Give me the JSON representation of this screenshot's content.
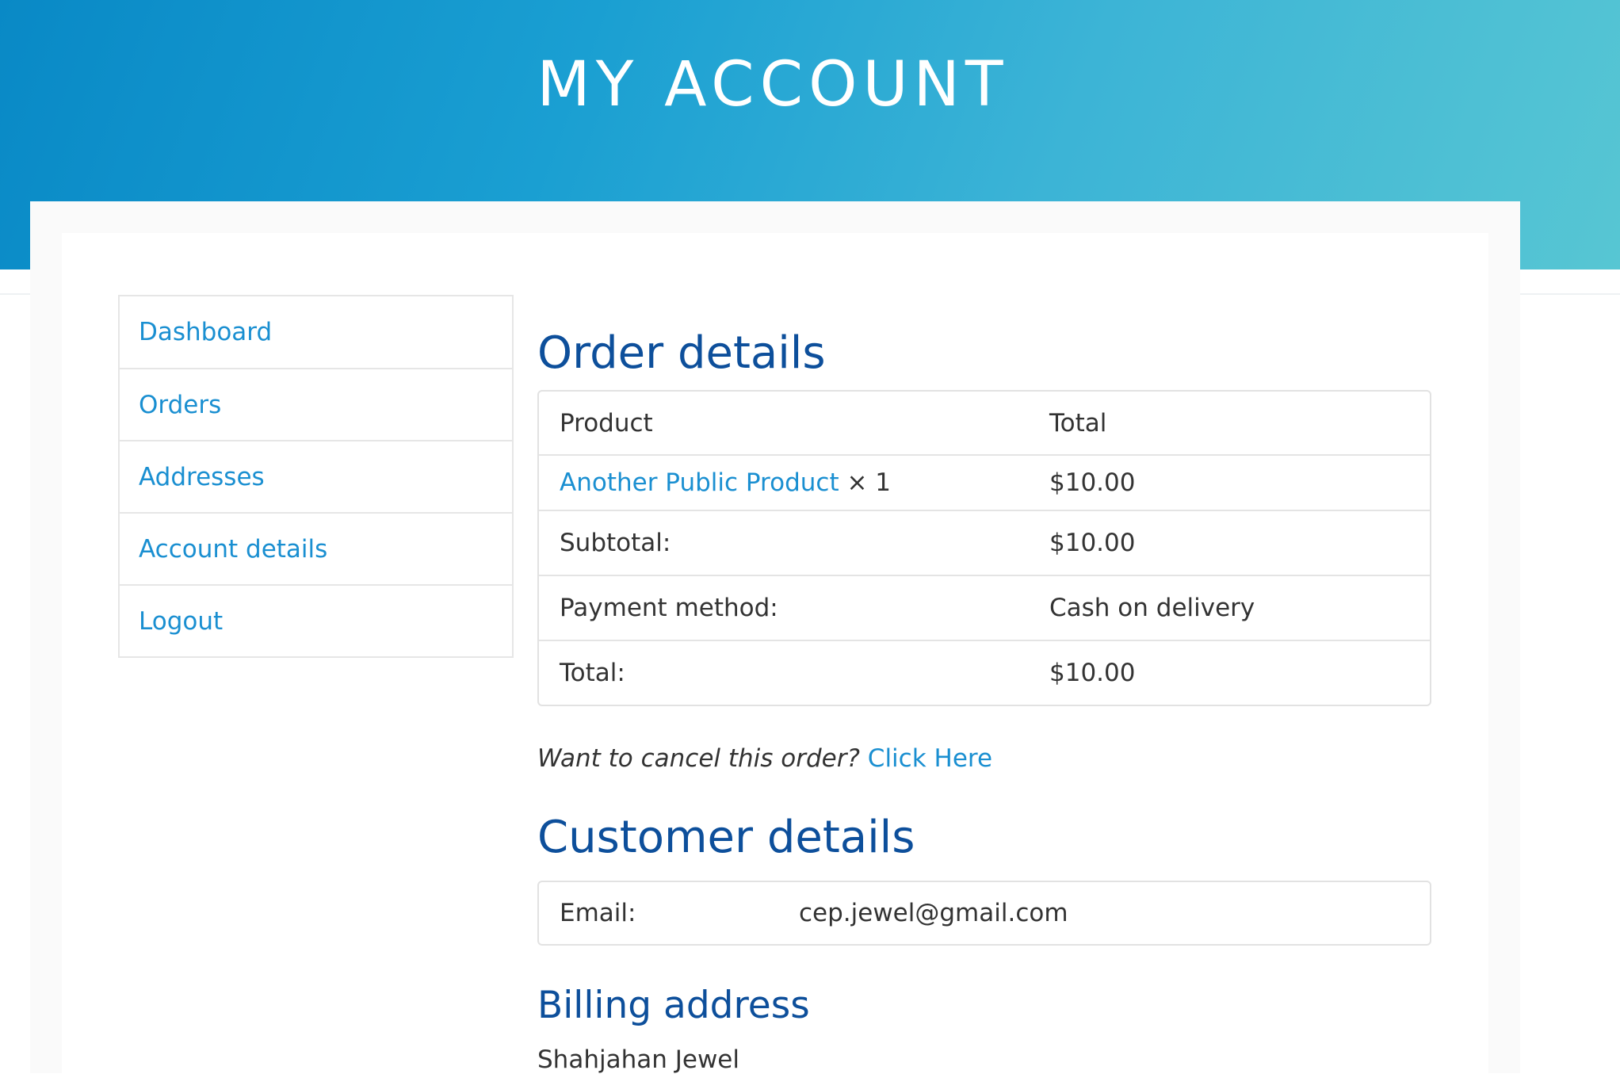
{
  "header": {
    "title": "MY ACCOUNT"
  },
  "sidebar": {
    "items": [
      {
        "label": "Dashboard"
      },
      {
        "label": "Orders"
      },
      {
        "label": "Addresses"
      },
      {
        "label": "Account details"
      },
      {
        "label": "Logout"
      }
    ]
  },
  "order": {
    "heading": "Order details",
    "columns": {
      "product": "Product",
      "total": "Total"
    },
    "item": {
      "name": "Another Public Product",
      "qty": "× 1",
      "total": "$10.00"
    },
    "subtotal": {
      "label": "Subtotal:",
      "value": "$10.00"
    },
    "payment": {
      "label": "Payment method:",
      "value": "Cash on delivery"
    },
    "grand_total": {
      "label": "Total:",
      "value": "$10.00"
    },
    "cancel": {
      "prompt": "Want to cancel this order?",
      "link": "Click Here"
    }
  },
  "customer": {
    "heading": "Customer details",
    "email_label": "Email:",
    "email": "cep.jewel@gmail.com"
  },
  "billing": {
    "heading": "Billing address",
    "name": "Shahjahan Jewel"
  },
  "colors": {
    "accent": "#1a8fd1",
    "heading": "#0d4f9b",
    "header_gradient_start": "#0989c6",
    "header_gradient_end": "#57c6d3"
  }
}
